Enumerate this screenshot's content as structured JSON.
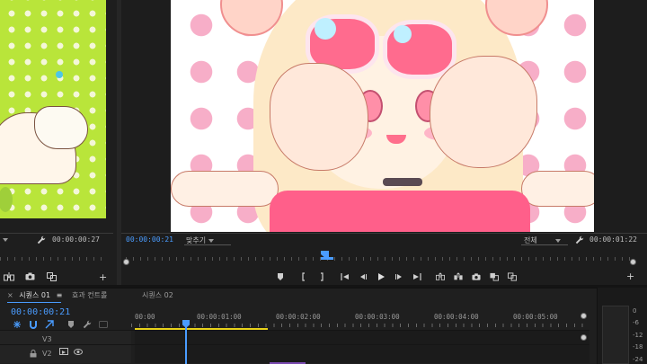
{
  "source_monitor": {
    "zoom_label": "",
    "timecode": "00:00:00:27"
  },
  "program_monitor": {
    "timecode": "00:00:00:21",
    "fit_dropdown": "맞추기",
    "resolution_dropdown": "전체",
    "duration": "00:00:01:22"
  },
  "timeline": {
    "tabs": [
      {
        "label": "시퀀스 01",
        "active": true,
        "close": "×",
        "menu": "≡"
      },
      {
        "label": "효과 컨트롤",
        "active": false
      },
      {
        "label": "시퀀스 02",
        "active": false
      }
    ],
    "timecode": "00:00:00:21",
    "ruler_labels": [
      "00:00",
      "00:00:01:00",
      "00:00:02:00",
      "00:00:03:00",
      "00:00:04:00",
      "00:00:05:00"
    ],
    "tracks": [
      {
        "name": "V3"
      },
      {
        "name": "V2"
      }
    ]
  },
  "audio_meter": {
    "db_labels": [
      "0",
      "-6",
      "-12",
      "-18",
      "-24"
    ]
  },
  "colors": {
    "accent": "#4a9cff",
    "workarea": "#e8d21a",
    "panel_bg": "#1d1d1d"
  },
  "icons": {
    "wrench": "wrench-icon",
    "marker": "marker-icon",
    "in_point": "mark-in-icon",
    "out_point": "mark-out-icon",
    "go_to_in": "go-to-in-icon",
    "step_back": "step-back-icon",
    "play": "play-icon",
    "step_forward": "step-forward-icon",
    "go_to_out": "go-to-out-icon",
    "insert": "insert-icon",
    "overwrite": "overwrite-icon",
    "export_frame": "camera-icon",
    "compare": "compare-icon",
    "add": "add-icon"
  }
}
